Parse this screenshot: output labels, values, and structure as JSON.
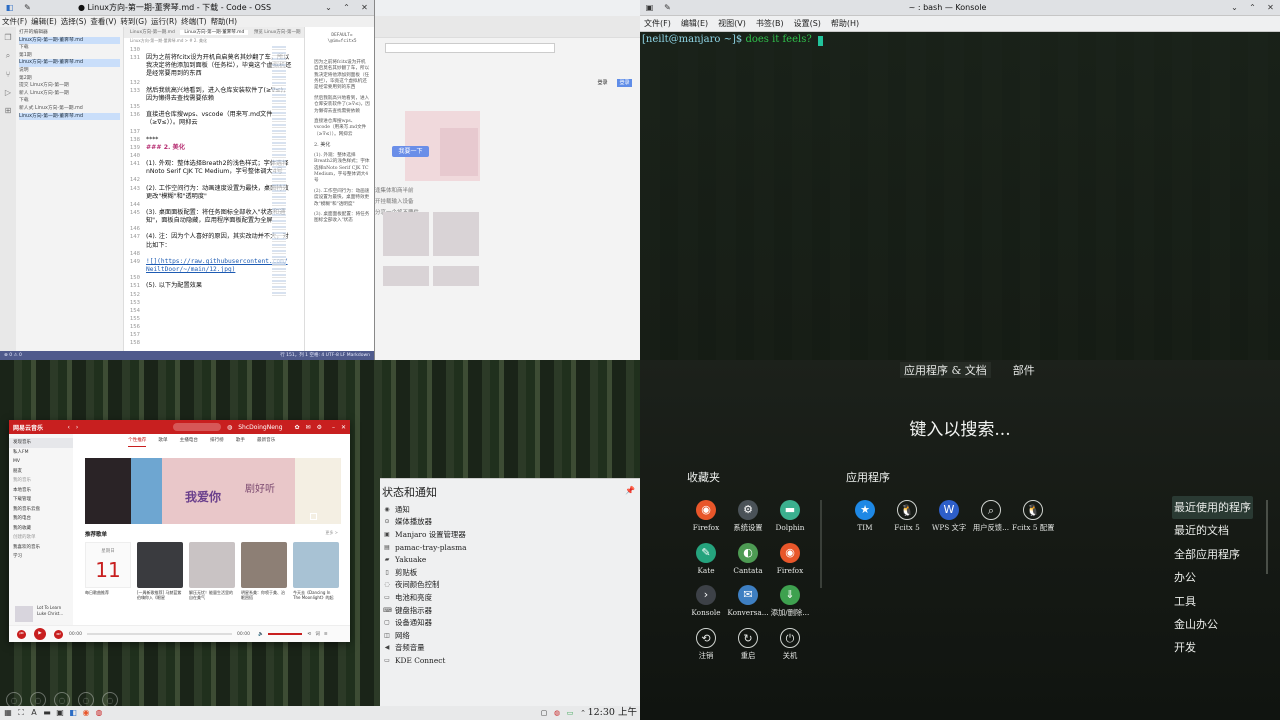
{
  "code": {
    "title": "● Linux方向-第一期-董霁琴.md - 下载 - Code - OSS",
    "menu": [
      "文件(F)",
      "编辑(E)",
      "选择(S)",
      "查看(V)",
      "转到(G)",
      "运行(R)",
      "终端(T)",
      "帮助(H)"
    ],
    "explorer": [
      "打开的编辑器",
      "Linux方向-第一期-董霁琴.md",
      "下载",
      "第1期",
      "Linux方向-第一期-董霁琴.md",
      "说明",
      "第2期",
      "提交 Linux方向-第一期",
      "新人 Linux方向-第一期",
      "下载",
      "新人式 Linux方向-第一期.md",
      "Linux方向-第一期-董霁琴.md"
    ],
    "tabs": [
      "Linux方向-第一期.md",
      "Linux方向-第一期-董霁琴.md",
      "预览 Linux方向-第一期"
    ],
    "breadcrumb": "Linux方向-第一期-董霁琴.md > # 2. 美化",
    "lines": [
      {
        "no": "130",
        "text": ""
      },
      {
        "no": "131",
        "text": "因为之前将fcitx设为开机自启莫名其妙翻了车，所以"
      },
      {
        "no": "",
        "text": "我决定将他添加到面板（任务栏），毕竟这个虚拟机还"
      },
      {
        "no": "",
        "text": "是经常要用到的东西"
      },
      {
        "no": "132",
        "text": ""
      },
      {
        "no": "133",
        "text": "然后我就高兴地看到，进入仓库安装软件了(≥∇≤)，"
      },
      {
        "no": "",
        "text": "因为懒得去查找需要依赖"
      },
      {
        "no": "135",
        "text": ""
      },
      {
        "no": "136",
        "text": "直接进仓库搜wps、vscode（用来写.md文件"
      },
      {
        "no": "",
        "text": "（≥∇≤））。网抑云"
      },
      {
        "no": "137",
        "text": ""
      },
      {
        "no": "138",
        "text": "****"
      },
      {
        "no": "139",
        "text": "### 2. 美化",
        "style": "h"
      },
      {
        "no": "140",
        "text": ""
      },
      {
        "no": "141",
        "text": "(1). 外观：整体选择Breath2的浅色样式；字体选择"
      },
      {
        "no": "",
        "text": "nNoto Serif CJK TC Medium，字号整体调大4号"
      },
      {
        "no": "142",
        "text": ""
      },
      {
        "no": "143",
        "text": "(2). 工作空间行为：动画速度设置为最快，桌面特效"
      },
      {
        "no": "",
        "text": "更改\"模糊\"和\"透明度\""
      },
      {
        "no": "144",
        "text": ""
      },
      {
        "no": "145",
        "text": "(3). 桌面面板配置：将任务图标全部收入\"状态和通"
      },
      {
        "no": "",
        "text": "知\"，面板自动隐藏，应用程序面板配置为全屏"
      },
      {
        "no": "146",
        "text": ""
      },
      {
        "no": "147",
        "text": "(4). 注：因为个人喜好的原因，其实改动并不大，对"
      },
      {
        "no": "",
        "text": "比如下："
      },
      {
        "no": "148",
        "text": ""
      },
      {
        "no": "149",
        "text": "![](https://raw.githubusercontent.com/",
        "style": "l"
      },
      {
        "no": "",
        "text": "NeiltDoor/~/main/12.jpg)",
        "style": "l"
      },
      {
        "no": "150",
        "text": ""
      },
      {
        "no": "151",
        "text": "(5). 以下为配置效果"
      },
      {
        "no": "152",
        "text": ""
      },
      {
        "no": "153",
        "text": ""
      },
      {
        "no": "154",
        "text": ""
      },
      {
        "no": "155",
        "text": ""
      },
      {
        "no": "156",
        "text": ""
      },
      {
        "no": "157",
        "text": ""
      },
      {
        "no": "158",
        "text": ""
      }
    ],
    "preview": {
      "code": "DEFAULT=\n\\@im=fcitx5",
      "paragraphs": [
        "因为之前将fcitx设为开机自启莫名其妙翻了车，所以我决定将他添加到面板（任务栏），毕竟这个虚拟机还是经常要用到的东西",
        "然后我就高兴地看到，进入仓库安装软件了(≥∇≤)，因为懒得去查找需要依赖",
        "直接进仓库搜wps、vscode（用来写.md文件（≥∇≤））。网抑云",
        "2. 美化",
        "(1). 外观：整体选择Breath2的浅色样式；字体选择nNoto Serif CJK TC Medium，字号整体调大4号",
        "(2). 工作空间行为：动画速度设置为最快，桌面特效更改\"模糊\"和\"透明度\"",
        "(3). 桌面面板配置：将任务图标全部收入\"状态"
      ]
    },
    "status_left": "⊗ 0 ⚠ 0",
    "status_right": "行 151，列 1  空格: 4  UTF-8  LF  Markdown"
  },
  "browser_ghost": {
    "blue_button": "我要一下",
    "lines": [
      "逢集体和商半前",
      "开挂载输入设备",
      "分享一个将不要件"
    ],
    "btn1": "登录",
    "btn2": "登录"
  },
  "konsole": {
    "title": "~ : bash — Konsole",
    "menu": [
      "文件(F)",
      "编辑(E)",
      "视图(V)",
      "书签(B)",
      "设置(S)",
      "帮助(H)"
    ],
    "prompt": "[neilt@manjaro ~]$",
    "command": "does it feels?"
  },
  "music": {
    "logo": "网易云音乐",
    "user": "ShcDoingNeng",
    "nav": [
      "个性推荐",
      "歌单",
      "主播电台",
      "排行榜",
      "歌手",
      "最新音乐"
    ],
    "sidebar": [
      {
        "label": "发现音乐",
        "sel": true
      },
      {
        "label": "私人FM"
      },
      {
        "label": "MV"
      },
      {
        "label": "朋友"
      },
      {
        "label": "我的音乐",
        "sec": true
      },
      {
        "label": "本地音乐"
      },
      {
        "label": "下载管理"
      },
      {
        "label": "我的音乐云盘"
      },
      {
        "label": "我的电台"
      },
      {
        "label": "我的收藏"
      },
      {
        "label": "创建的歌单",
        "sec": true
      },
      {
        "label": "我喜欢的音乐"
      },
      {
        "label": "学习"
      }
    ],
    "banner_text1": "我爱你",
    "banner_text2": "剧好听",
    "rec_title": "推荐歌单",
    "rec_more": "更多 >",
    "daily_week": "星期日",
    "daily_day": "11",
    "cards": [
      {
        "cap": "每日歌曲推荐",
        "color": "#fafafa"
      },
      {
        "cap": "[一周新歌推荐] 马赫蓝紫伯嗨你入《眼星",
        "color": "#3a3b3f"
      },
      {
        "cap": "解压无忧！能量生活里的自在美气",
        "color": "#c9c3c4"
      },
      {
        "cap": "明星系美：你喷于美、治眠困搭",
        "color": "#8d7f75"
      },
      {
        "cap": "今天去《Dancing In The Moonlight》的起",
        "color": "#a8c2d4"
      }
    ],
    "now_title": "Lot To Learn",
    "now_artist": "Luke Christ...",
    "time_start": "00:00",
    "time_end": "00:00"
  },
  "notif": {
    "title": "状态和通知",
    "items": [
      {
        "icon": "bell-icon",
        "glyph": "◉",
        "label": "通知"
      },
      {
        "icon": "media-player-icon",
        "glyph": "⊙",
        "label": "媒体播放器"
      },
      {
        "icon": "manjaro-settings-icon",
        "glyph": "▣",
        "label": "Manjaro 设置管理器"
      },
      {
        "icon": "pamac-icon",
        "glyph": "▤",
        "label": "pamac-tray-plasma"
      },
      {
        "icon": "yakuake-icon",
        "glyph": "▰",
        "label": "Yakuake"
      },
      {
        "icon": "clipboard-icon",
        "glyph": "▯",
        "label": "剪贴板"
      },
      {
        "icon": "night-color-icon",
        "glyph": "◌",
        "label": "夜间颜色控制"
      },
      {
        "icon": "battery-icon",
        "glyph": "▭",
        "label": "电池和亮度"
      },
      {
        "icon": "keyboard-icon",
        "glyph": "⌨",
        "label": "键盘指示器"
      },
      {
        "icon": "device-notifier-icon",
        "glyph": "▢",
        "label": "设备通知器"
      },
      {
        "icon": "network-icon",
        "glyph": "◫",
        "label": "网络"
      },
      {
        "icon": "audio-volume-icon",
        "glyph": "◀",
        "label": "音频音量"
      },
      {
        "icon": "kde-connect-icon",
        "glyph": "▭",
        "label": "KDE Connect"
      }
    ]
  },
  "taskbar": {
    "clock": "12:30 上午"
  },
  "launcher": {
    "tabs": [
      "应用程序 & 文档",
      "部件"
    ],
    "search_hint": "键入以搜索...",
    "fav_title": "收藏夹",
    "apps_title": "应用程序",
    "favorites": [
      {
        "label": "Firefox",
        "icon": "firefox-icon",
        "glyph": "◉",
        "color": "#e8562a"
      },
      {
        "label": "系统设置",
        "icon": "system-settings-icon",
        "glyph": "⚙",
        "color": "#4a5258"
      },
      {
        "label": "Dolphin",
        "icon": "dolphin-icon",
        "glyph": "▬",
        "color": "#3bb08f"
      },
      {
        "label": "Kate",
        "icon": "kate-icon",
        "glyph": "✎",
        "color": "#25a37d"
      },
      {
        "label": "Cantata",
        "icon": "cantata-icon",
        "glyph": "◐",
        "color": "#4d9b53"
      },
      {
        "label": "Firefox",
        "icon": "firefox-icon",
        "glyph": "◉",
        "color": "#e8562a"
      },
      {
        "label": "Konsole",
        "icon": "konsole-icon",
        "glyph": "›",
        "color": "#3d4147"
      },
      {
        "label": "Konversa...",
        "icon": "konversation-icon",
        "glyph": "✉",
        "color": "#3e7fc2"
      },
      {
        "label": "添加/删除...",
        "icon": "package-icon",
        "glyph": "⇓",
        "color": "#3ea14f"
      },
      {
        "label": "注销",
        "icon": "logout-icon",
        "glyph": "⟲",
        "color": "transparent"
      },
      {
        "label": "重启",
        "icon": "restart-icon",
        "glyph": "↻",
        "color": "transparent"
      },
      {
        "label": "关机",
        "icon": "power-icon",
        "glyph": "⏻",
        "color": "transparent"
      }
    ],
    "apps": [
      {
        "label": "TIM",
        "icon": "tim-icon",
        "glyph": "★",
        "color": "#1e88e5"
      },
      {
        "label": "Fcitx 5",
        "icon": "fcitx-icon",
        "glyph": "🐧",
        "color": "transparent"
      },
      {
        "label": "WPS 文字",
        "icon": "wps-writer-icon",
        "glyph": "W",
        "color": "#2d5ec9"
      },
      {
        "label": "用户反馈...",
        "icon": "search-icon",
        "glyph": "⌕",
        "color": "transparent"
      },
      {
        "label": "Fcitx 5 配置",
        "icon": "fcitx-config-icon",
        "glyph": "🐧",
        "color": "transparent"
      }
    ],
    "categories": [
      "最近使用的程序",
      "最近的文档",
      "全部应用程序",
      "办公",
      "工具",
      "金山办公",
      "开发"
    ]
  }
}
